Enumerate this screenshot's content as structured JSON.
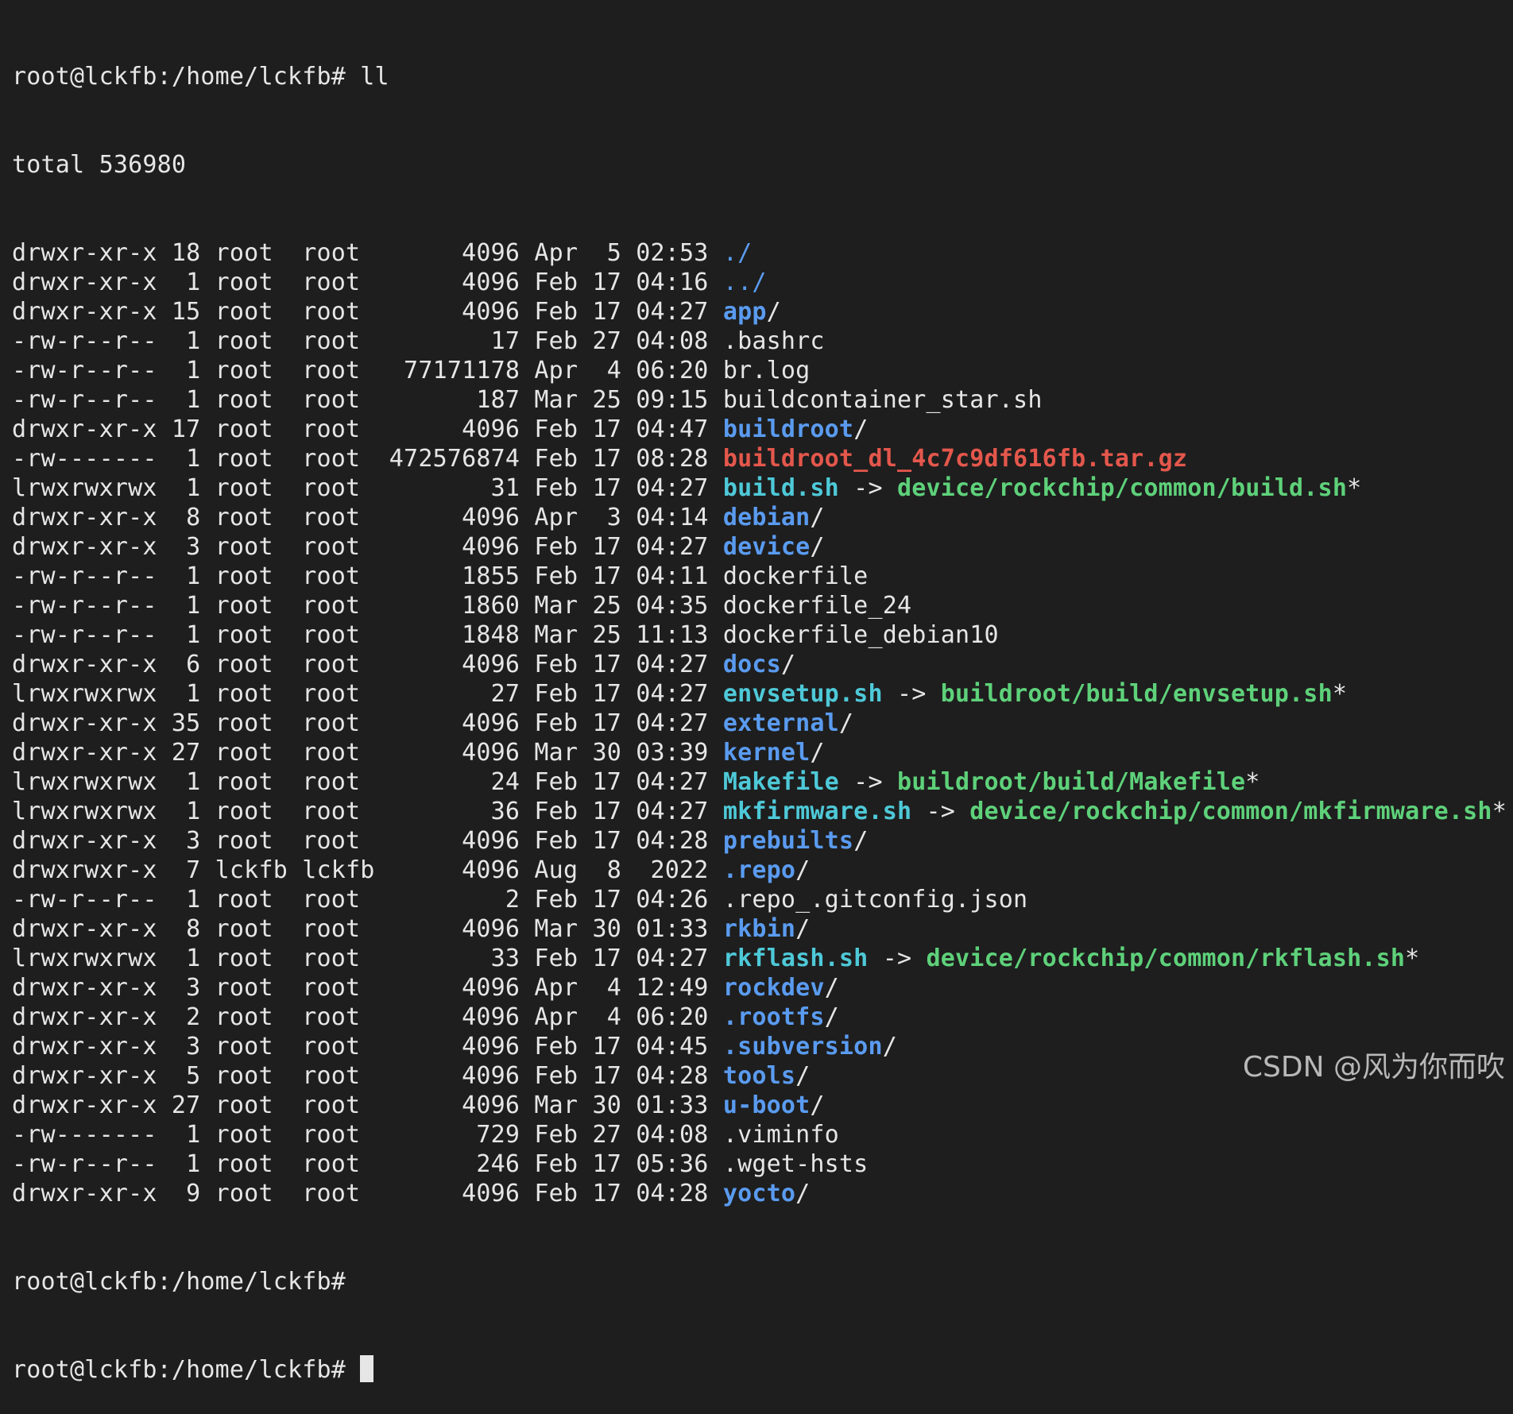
{
  "prompt_first": "root@lckfb:/home/lckfb# ll",
  "total_line": "total 536980",
  "entries": [
    {
      "meta": "drwxr-xr-x 18 root  root       4096 Apr  5 02:53 ",
      "name": "./",
      "kind": "dir-dot",
      "slash": ""
    },
    {
      "meta": "drwxr-xr-x  1 root  root       4096 Feb 17 04:16 ",
      "name": "../",
      "kind": "dir-dot",
      "slash": ""
    },
    {
      "meta": "drwxr-xr-x 15 root  root       4096 Feb 17 04:27 ",
      "name": "app",
      "kind": "dir",
      "slash": "/"
    },
    {
      "meta": "-rw-r--r--  1 root  root         17 Feb 27 04:08 ",
      "name": ".bashrc",
      "kind": "file",
      "slash": ""
    },
    {
      "meta": "-rw-r--r--  1 root  root   77171178 Apr  4 06:20 ",
      "name": "br.log",
      "kind": "file",
      "slash": ""
    },
    {
      "meta": "-rw-r--r--  1 root  root        187 Mar 25 09:15 ",
      "name": "buildcontainer_star.sh",
      "kind": "file",
      "slash": ""
    },
    {
      "meta": "drwxr-xr-x 17 root  root       4096 Feb 17 04:47 ",
      "name": "buildroot",
      "kind": "dir",
      "slash": "/"
    },
    {
      "meta": "-rw-------  1 root  root  472576874 Feb 17 08:28 ",
      "name": "buildroot_dl_4c7c9df616fb.tar.gz",
      "kind": "archive",
      "slash": ""
    },
    {
      "meta": "lrwxrwxrwx  1 root  root         31 Feb 17 04:27 ",
      "name": "build.sh",
      "kind": "link",
      "arrow": " -> ",
      "target": "device/rockchip/common/build.sh",
      "star": "*"
    },
    {
      "meta": "drwxr-xr-x  8 root  root       4096 Apr  3 04:14 ",
      "name": "debian",
      "kind": "dir",
      "slash": "/"
    },
    {
      "meta": "drwxr-xr-x  3 root  root       4096 Feb 17 04:27 ",
      "name": "device",
      "kind": "dir",
      "slash": "/"
    },
    {
      "meta": "-rw-r--r--  1 root  root       1855 Feb 17 04:11 ",
      "name": "dockerfile",
      "kind": "file",
      "slash": ""
    },
    {
      "meta": "-rw-r--r--  1 root  root       1860 Mar 25 04:35 ",
      "name": "dockerfile_24",
      "kind": "file",
      "slash": ""
    },
    {
      "meta": "-rw-r--r--  1 root  root       1848 Mar 25 11:13 ",
      "name": "dockerfile_debian10",
      "kind": "file",
      "slash": ""
    },
    {
      "meta": "drwxr-xr-x  6 root  root       4096 Feb 17 04:27 ",
      "name": "docs",
      "kind": "dir",
      "slash": "/"
    },
    {
      "meta": "lrwxrwxrwx  1 root  root         27 Feb 17 04:27 ",
      "name": "envsetup.sh",
      "kind": "link",
      "arrow": " -> ",
      "target": "buildroot/build/envsetup.sh",
      "star": "*"
    },
    {
      "meta": "drwxr-xr-x 35 root  root       4096 Feb 17 04:27 ",
      "name": "external",
      "kind": "dir",
      "slash": "/"
    },
    {
      "meta": "drwxr-xr-x 27 root  root       4096 Mar 30 03:39 ",
      "name": "kernel",
      "kind": "dir",
      "slash": "/"
    },
    {
      "meta": "lrwxrwxrwx  1 root  root         24 Feb 17 04:27 ",
      "name": "Makefile",
      "kind": "link",
      "arrow": " -> ",
      "target": "buildroot/build/Makefile",
      "star": "*"
    },
    {
      "meta": "lrwxrwxrwx  1 root  root         36 Feb 17 04:27 ",
      "name": "mkfirmware.sh",
      "kind": "link",
      "arrow": " -> ",
      "target": "device/rockchip/common/mkfirmware.sh",
      "star": "*"
    },
    {
      "meta": "drwxr-xr-x  3 root  root       4096 Feb 17 04:28 ",
      "name": "prebuilts",
      "kind": "dir",
      "slash": "/"
    },
    {
      "meta": "drwxrwxr-x  7 lckfb lckfb      4096 Aug  8  2022 ",
      "name": ".repo",
      "kind": "dir",
      "slash": "/"
    },
    {
      "meta": "-rw-r--r--  1 root  root          2 Feb 17 04:26 ",
      "name": ".repo_.gitconfig.json",
      "kind": "file",
      "slash": ""
    },
    {
      "meta": "drwxr-xr-x  8 root  root       4096 Mar 30 01:33 ",
      "name": "rkbin",
      "kind": "dir",
      "slash": "/"
    },
    {
      "meta": "lrwxrwxrwx  1 root  root         33 Feb 17 04:27 ",
      "name": "rkflash.sh",
      "kind": "link",
      "arrow": " -> ",
      "target": "device/rockchip/common/rkflash.sh",
      "star": "*"
    },
    {
      "meta": "drwxr-xr-x  3 root  root       4096 Apr  4 12:49 ",
      "name": "rockdev",
      "kind": "dir",
      "slash": "/"
    },
    {
      "meta": "drwxr-xr-x  2 root  root       4096 Apr  4 06:20 ",
      "name": ".rootfs",
      "kind": "dir",
      "slash": "/"
    },
    {
      "meta": "drwxr-xr-x  3 root  root       4096 Feb 17 04:45 ",
      "name": ".subversion",
      "kind": "dir",
      "slash": "/"
    },
    {
      "meta": "drwxr-xr-x  5 root  root       4096 Feb 17 04:28 ",
      "name": "tools",
      "kind": "dir",
      "slash": "/"
    },
    {
      "meta": "drwxr-xr-x 27 root  root       4096 Mar 30 01:33 ",
      "name": "u-boot",
      "kind": "dir",
      "slash": "/"
    },
    {
      "meta": "-rw-------  1 root  root        729 Feb 27 04:08 ",
      "name": ".viminfo",
      "kind": "file",
      "slash": ""
    },
    {
      "meta": "-rw-r--r--  1 root  root        246 Feb 17 05:36 ",
      "name": ".wget-hsts",
      "kind": "file",
      "slash": ""
    },
    {
      "meta": "drwxr-xr-x  9 root  root       4096 Feb 17 04:28 ",
      "name": "yocto",
      "kind": "dir",
      "slash": "/"
    }
  ],
  "prompt_second": "root@lckfb:/home/lckfb#",
  "prompt_third": "root@lckfb:/home/lckfb# ",
  "watermark": "CSDN @风为你而吹",
  "colors": {
    "background": "#1e1e1e",
    "text": "#e6e6e6",
    "directory": "#5a9bf0",
    "symlink": "#4ec9d8",
    "link_target": "#5ed17a",
    "archive": "#e4574c"
  }
}
